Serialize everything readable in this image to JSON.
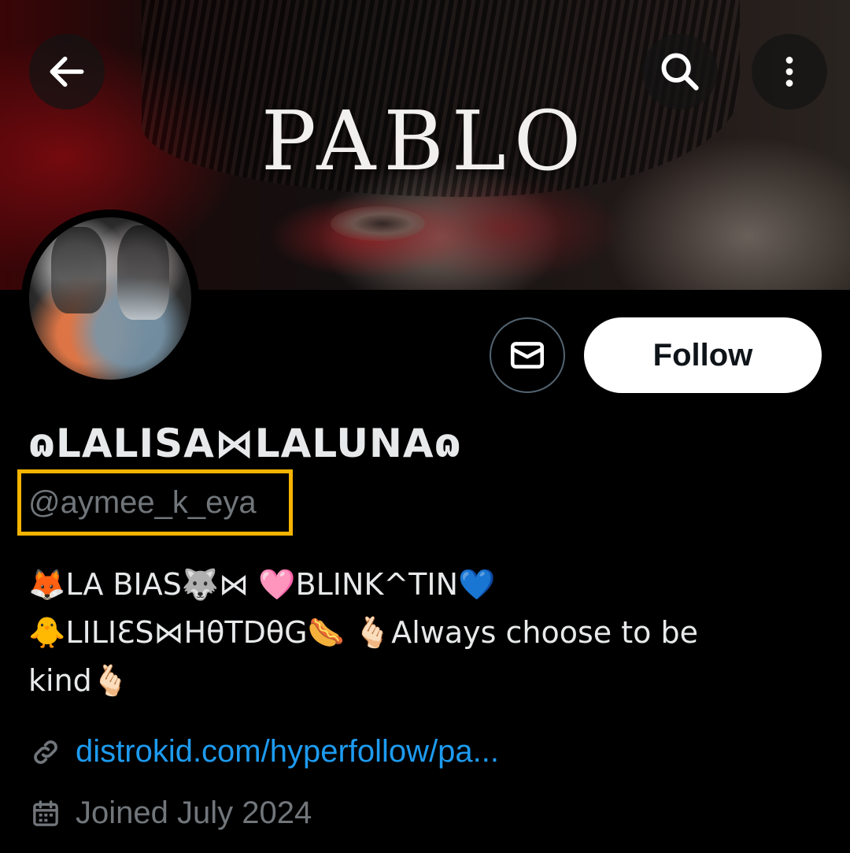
{
  "banner": {
    "title_text": "PABLO"
  },
  "header": {
    "back_icon": "arrow-left-icon",
    "search_icon": "search-icon",
    "more_icon": "more-vertical-icon"
  },
  "profile": {
    "display_name": "ɷLALISA⋈LALUNAɷ",
    "handle": "@aymee_k_eya",
    "bio_lines": [
      "🦊LA BIAS🐺⋈ 🩷BLINK^TIN💙",
      "🐥LILIƐS⋈HθTDθG🌭 🫰🏻Always choose to be",
      "kind🫰🏻"
    ],
    "link": "distrokid.com/hyperfollow/pa...",
    "joined": "Joined July 2024"
  },
  "actions": {
    "follow_label": "Follow",
    "message_icon": "envelope-icon"
  },
  "colors": {
    "background": "#000000",
    "text_primary": "#e7e9ea",
    "text_secondary": "#71767b",
    "link": "#1d9bf0",
    "highlight_box": "#f5b400",
    "follow_bg": "#ffffff"
  }
}
